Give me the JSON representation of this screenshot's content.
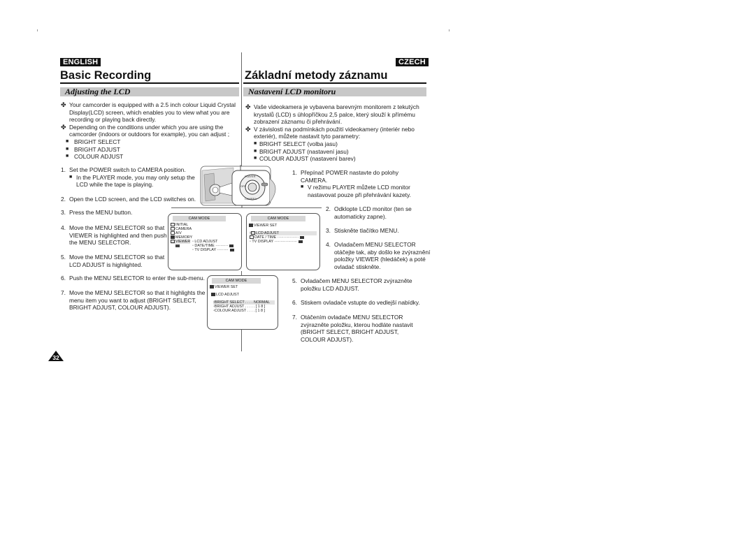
{
  "header": {
    "left_lang": "ENGLISH",
    "right_lang": "CZECH",
    "left_title": "Basic Recording",
    "right_title": "Základní metody záznamu",
    "left_section": "Adjusting the LCD",
    "right_section": "Nastavení LCD monitoru"
  },
  "english": {
    "intro": [
      "Your camcorder is equipped with a 2.5 inch colour Liquid Crystal Display(LCD) screen, which enables you to view what you are recording or playing back directly.",
      "Depending on the conditions under which you are using the camcorder (indoors or outdoors for example), you can adjust ;"
    ],
    "options": [
      "BRIGHT SELECT",
      "BRIGHT ADJUST",
      "COLOUR ADJUST"
    ],
    "steps": [
      {
        "num": "1.",
        "text": "Set the POWER switch to CAMERA position.",
        "note": "In the PLAYER mode, you may only setup the LCD while the tape is playing."
      },
      {
        "num": "2.",
        "text": "Open the LCD screen, and the LCD switches on."
      },
      {
        "num": "3.",
        "text": "Press the MENU button."
      },
      {
        "num": "4.",
        "text": "Move the MENU SELECTOR so that VIEWER is highlighted and then push the MENU SELECTOR."
      },
      {
        "num": "5.",
        "text": "Move the MENU SELECTOR so that LCD ADJUST is highlighted."
      },
      {
        "num": "6.",
        "text": "Push the MENU SELECTOR to enter the sub-menu."
      },
      {
        "num": "7.",
        "text": "Move the MENU SELECTOR so that it highlights the menu item you want to adjust (BRIGHT SELECT, BRIGHT ADJUST, COLOUR ADJUST)."
      }
    ]
  },
  "czech": {
    "intro": [
      "Vaše videokamera je vybavena barevným monitorem z tekutých krystalů (LCD) s úhlopříčkou 2,5 palce, který slouží k přímému zobrazení záznamu či přehrávání.",
      "V závislosti na podmínkách použití videokamery (interiér nebo exteriér), můžete nastavit tyto parametry:"
    ],
    "options": [
      "BRIGHT SELECT (volba jasu)",
      "BRIGHT ADJUST (nastavení jasu)",
      "COLOUR ADJUST (nastavení barev)"
    ],
    "steps": [
      {
        "num": "1.",
        "text": "Přepínač POWER nastavte do polohy CAMERA.",
        "note": "V režimu PLAYER můžete LCD monitor nastavovat pouze při přehrávání kazety."
      },
      {
        "num": "2.",
        "text": "Odklopte LCD monitor (ten se automaticky zapne)."
      },
      {
        "num": "3.",
        "text": "Stiskněte tlačítko MENU."
      },
      {
        "num": "4.",
        "text": "Ovladačem MENU SELECTOR otáčejte tak, aby došlo ke zvýraznění položky VIEWER (hledáček) a poté ovladač stiskněte."
      },
      {
        "num": "5.",
        "text": "Ovladačem MENU SELECTOR zvýrazněte položku LCD ADJUST."
      },
      {
        "num": "6.",
        "text": "Stiskem ovladače vstupte do vedlejší nabídky."
      },
      {
        "num": "7.",
        "text": "Otáčením ovladače MENU SELECTOR zvýrazněte položku, kterou hodláte nastavit (BRIGHT SELECT, BRIGHT ADJUST, COLOUR ADJUST)."
      }
    ]
  },
  "screens": {
    "cam_mode": "CAM MODE",
    "screen1": {
      "menu": [
        "INITIAL",
        "CAMERA",
        "A/V",
        "MEMORY",
        "VIEWER"
      ],
      "sub": [
        "LCD ADJUST",
        "DATE/TIME",
        "TV DISPLAY"
      ]
    },
    "screen2": {
      "heading": "VIEWER SET",
      "items": [
        "LCD ADJUST",
        "DATE / TIME",
        "TV DISPLAY"
      ]
    },
    "screen3": {
      "heading": "VIEWER SET",
      "sub_heading": "LCD ADJUST",
      "items": [
        {
          "label": "BRIGHT SELECT",
          "value": "NORMAL"
        },
        {
          "label": "BRIGHT ADJUST",
          "value": "[ 1 8 ]"
        },
        {
          "label": "COLOUR ADJUST",
          "value": "[ 1 8 ]"
        }
      ]
    }
  },
  "camera_dial_labels": [
    "PLAYER",
    "OFF",
    "CAMERA"
  ],
  "page_number": "32",
  "markers": {
    "bullet": "✤",
    "square": "■"
  }
}
